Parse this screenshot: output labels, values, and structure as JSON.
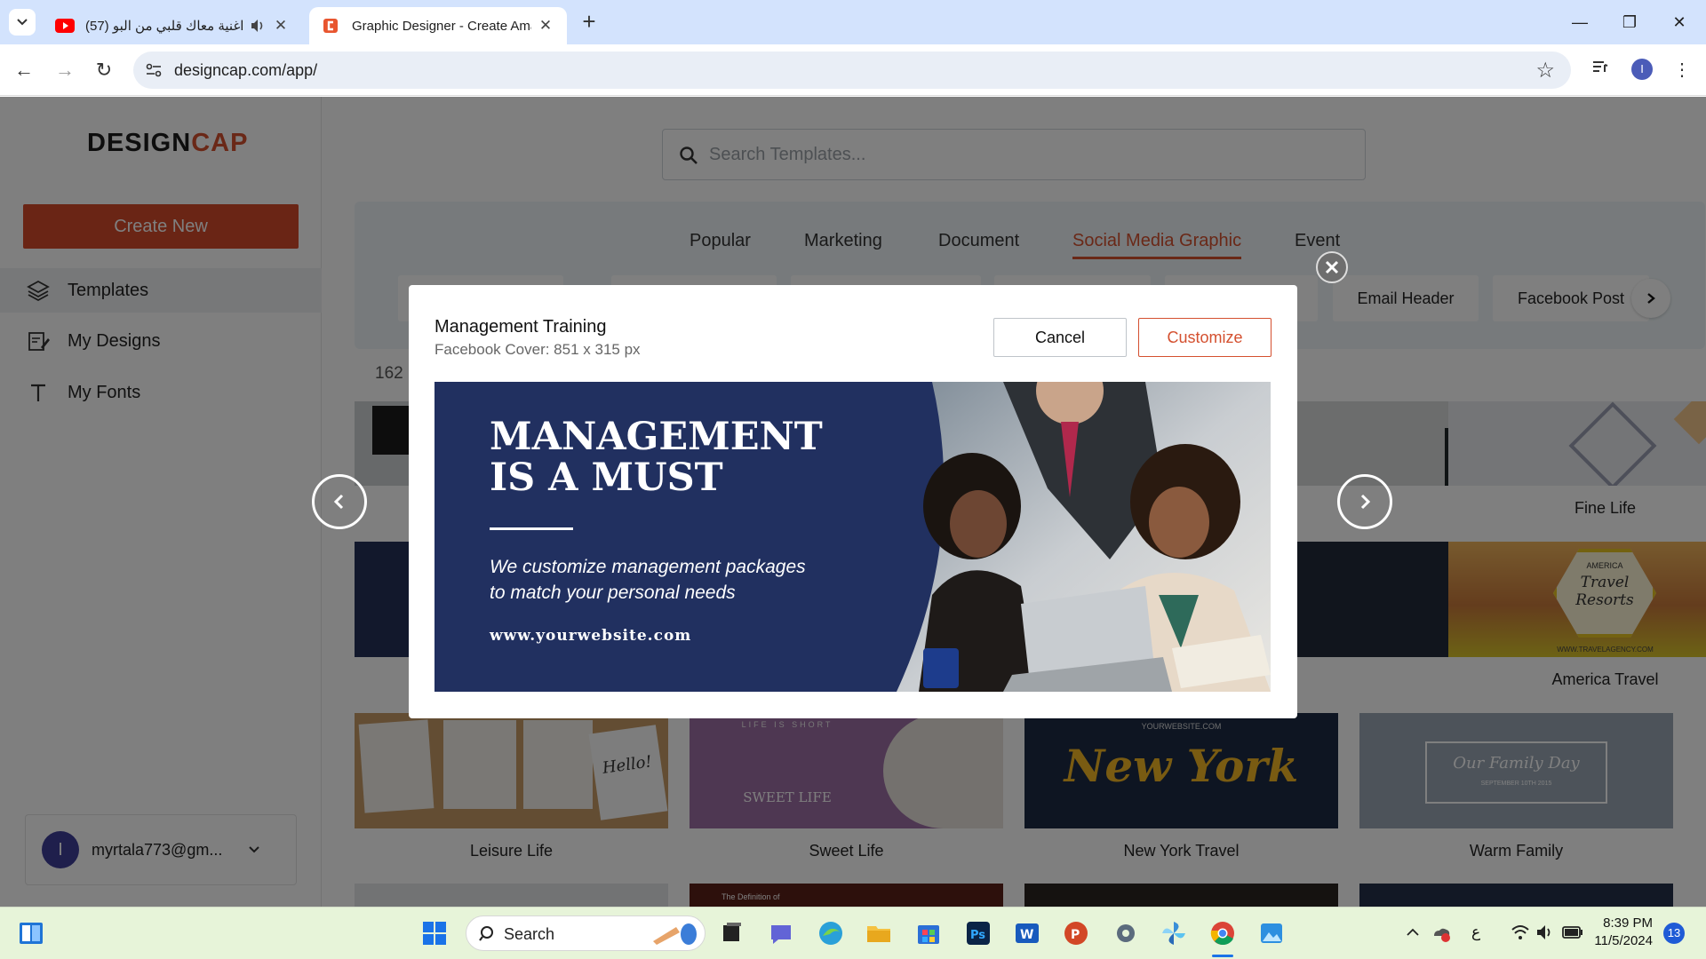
{
  "browser": {
    "tabs": [
      {
        "title": "(57) اغنية معاك قلبي من البو",
        "active": false
      },
      {
        "title": "Graphic Designer - Create Ama",
        "active": true
      }
    ],
    "url": "designcap.com/app/",
    "profile_initial": "I"
  },
  "sidebar": {
    "logo_design": "DESIGN",
    "logo_cap": "CAP",
    "create_label": "Create New",
    "items": [
      {
        "label": "Templates",
        "icon": "layers-icon",
        "active": true
      },
      {
        "label": "My Designs",
        "icon": "edit-document-icon",
        "active": false
      },
      {
        "label": "My Fonts",
        "icon": "font-icon",
        "active": false
      }
    ],
    "account": {
      "initial": "I",
      "email": "myrtala773@gm..."
    }
  },
  "main": {
    "search_placeholder": "Search Templates...",
    "categories": [
      "Popular",
      "Marketing",
      "Document",
      "Social Media Graphic",
      "Event"
    ],
    "active_category": "Social Media Graphic",
    "chips": [
      "Email Header",
      "Facebook Post"
    ],
    "count_text": "162",
    "templates": [
      {
        "name": "Fine Life"
      },
      {
        "name": "America Travel"
      },
      {
        "name": "Leisure Life"
      },
      {
        "name": "Sweet Life"
      },
      {
        "name": "New York Travel"
      },
      {
        "name": "Warm Family"
      }
    ],
    "thumb_text": {
      "travel_badge_top": "AMERICA",
      "travel_badge": "Travel Resorts",
      "travel_url": "WWW.TRAVELAGENCY.COM",
      "hello": "Hello!",
      "sweet": "SWEET LIFE",
      "sweet_top": "LIFE IS SHORT",
      "ny_top": "YOURWEBSITE.COM",
      "ny": "New York",
      "family": "Our Family Day",
      "family_date": "SEPTEMBER 10TH 2015",
      "bottom_left": "The Definition of"
    }
  },
  "modal": {
    "title": "Management Training",
    "subtitle": "Facebook Cover: 851 x 315 px",
    "cancel_label": "Cancel",
    "customize_label": "Customize",
    "preview": {
      "headline_1": "MANAGEMENT",
      "headline_2": "IS A MUST",
      "tagline_1": "We customize management packages",
      "tagline_2": "to match your personal needs",
      "website": "www.yourwebsite.com"
    }
  },
  "taskbar": {
    "search_label": "Search",
    "time": "8:39 PM",
    "date": "11/5/2024",
    "lang": "ع",
    "notifications": "13"
  },
  "colors": {
    "accent": "#d4502f",
    "navy": "#213060"
  }
}
